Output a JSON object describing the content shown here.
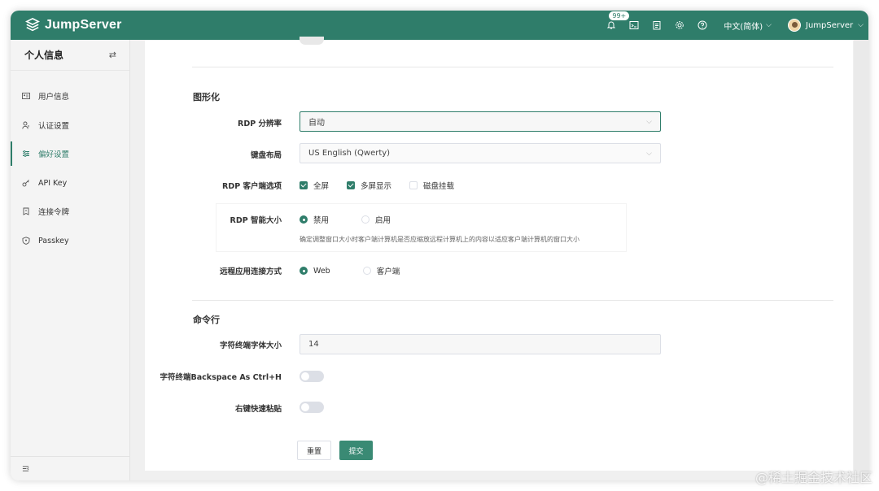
{
  "header": {
    "app_name": "JumpServer",
    "notifications_badge": "99+",
    "language": "中文(简体)",
    "username": "JumpServer",
    "icons": [
      "bell-icon",
      "terminal-icon",
      "clipboard-icon",
      "gear-icon",
      "help-icon"
    ]
  },
  "sidebar": {
    "title": "个人信息",
    "toggle_icon": "swap-icon",
    "items": [
      {
        "label": "用户信息",
        "icon": "id-card-icon",
        "active": false
      },
      {
        "label": "认证设置",
        "icon": "user-shield-icon",
        "active": false
      },
      {
        "label": "偏好设置",
        "icon": "sliders-icon",
        "active": true
      },
      {
        "label": "API Key",
        "icon": "key-icon",
        "active": false
      },
      {
        "label": "连接令牌",
        "icon": "token-icon",
        "active": false
      },
      {
        "label": "Passkey",
        "icon": "passkey-icon",
        "active": false
      }
    ]
  },
  "graphics": {
    "section_title": "图形化",
    "rdp_resolution": {
      "label": "RDP 分辨率",
      "value": "自动"
    },
    "keyboard_layout": {
      "label": "键盘布局",
      "value": "US English (Qwerty)"
    },
    "rdp_client_options": {
      "label": "RDP 客户端选项",
      "options": [
        {
          "label": "全屏",
          "checked": true
        },
        {
          "label": "多屏显示",
          "checked": true
        },
        {
          "label": "磁盘挂载",
          "checked": false
        }
      ]
    },
    "rdp_smart_size": {
      "label": "RDP 智能大小",
      "options": [
        {
          "label": "禁用",
          "selected": true
        },
        {
          "label": "启用",
          "selected": false
        }
      ],
      "help": "确定调整窗口大小时客户端计算机是否应缩放远程计算机上的内容以适应客户端计算机的窗口大小"
    },
    "remote_app_connect": {
      "label": "远程应用连接方式",
      "options": [
        {
          "label": "Web",
          "selected": true
        },
        {
          "label": "客户端",
          "selected": false
        }
      ]
    }
  },
  "command_line": {
    "section_title": "命令行",
    "font_size": {
      "label": "字符终端字体大小",
      "value": "14"
    },
    "backspace_ctrl_h": {
      "label": "字符终端Backspace As Ctrl+H",
      "enabled": false
    },
    "right_click_paste": {
      "label": "右键快速粘贴",
      "enabled": false
    }
  },
  "actions": {
    "reset": "重置",
    "submit": "提交"
  },
  "watermark": "@稀土掘金技术社区",
  "colors": {
    "brand": "#2f7d6a",
    "submit": "#3a8a74"
  }
}
